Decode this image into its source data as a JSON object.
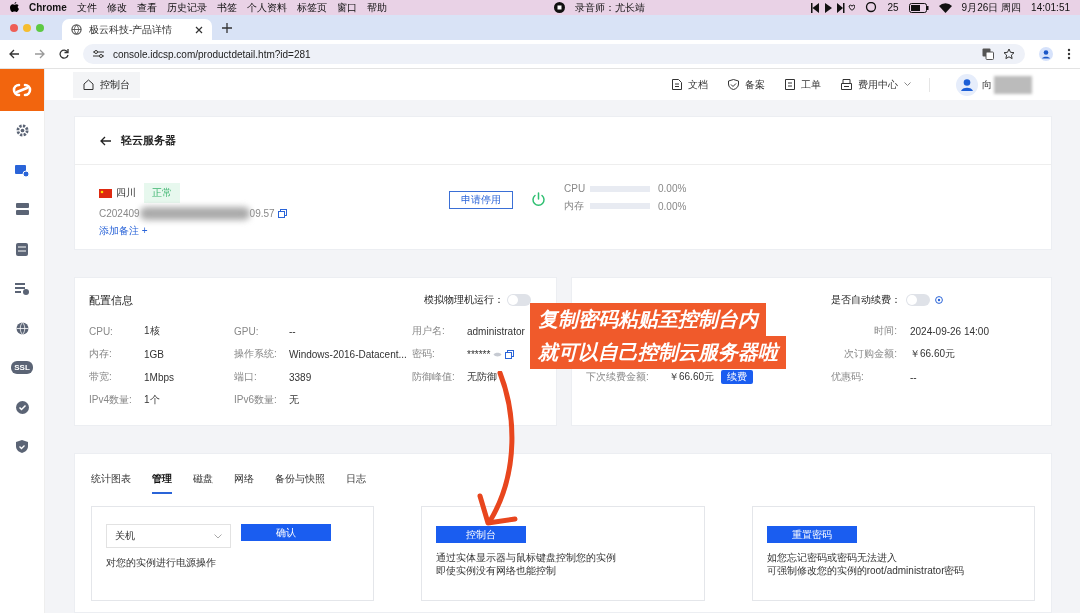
{
  "menubar": {
    "app": "Chrome",
    "items": [
      "文件",
      "修改",
      "查看",
      "历史记录",
      "书签",
      "个人资料",
      "标签页",
      "窗口",
      "帮助"
    ],
    "recorder": "录音师：尤长靖",
    "badge_count": "25",
    "date": "9月26日 周四",
    "time": "14:01:51"
  },
  "browser": {
    "tab_title": "极云科技-产品详情",
    "url": "console.idcsp.com/productdetail.htm?id=281"
  },
  "header": {
    "console": "控制台",
    "nav": [
      {
        "label": "文档",
        "kind": "doc"
      },
      {
        "label": "备案",
        "kind": "shield"
      },
      {
        "label": "工单",
        "kind": "ticket"
      },
      {
        "label": "费用中心",
        "kind": "cost"
      }
    ],
    "user": "向"
  },
  "sidebar": {
    "items": [
      {
        "kind": "gear",
        "selected": false
      },
      {
        "kind": "server",
        "selected": true
      },
      {
        "kind": "stack",
        "selected": false
      },
      {
        "kind": "db",
        "selected": false
      },
      {
        "kind": "list",
        "selected": false
      },
      {
        "kind": "globe",
        "selected": false
      },
      {
        "kind": "ssl",
        "label": "SSL",
        "selected": false
      },
      {
        "kind": "check",
        "selected": false
      },
      {
        "kind": "shield",
        "selected": false
      }
    ]
  },
  "server": {
    "title": "轻云服务器",
    "region": "四川",
    "status": "正常",
    "id_start": "C202409",
    "id_end": "09.57",
    "add_note": "添加备注 +",
    "stop_button": "申请停用",
    "running": true,
    "meters": [
      {
        "label": "CPU",
        "level": 0,
        "reading": "0.00%"
      },
      {
        "label": "内存",
        "level": 0,
        "reading": "0.00%"
      }
    ]
  },
  "config": {
    "title": "配置信息",
    "simulate_label": "模拟物理机运行：",
    "simulate_on": false,
    "rows": [
      [
        {
          "label": "CPU:",
          "value": "1核"
        },
        {
          "label": "GPU:",
          "value": "--"
        },
        {
          "label": "用户名:",
          "value": "administrator"
        }
      ],
      [
        {
          "label": "内存:",
          "value": "1GB"
        },
        {
          "label": "操作系统:",
          "value": "Windows-2016-Datacent..."
        },
        {
          "label": "密码:",
          "value": "******",
          "kind": "password"
        }
      ],
      [
        {
          "label": "带宽:",
          "value": "1Mbps"
        },
        {
          "label": "端口:",
          "value": "3389"
        },
        {
          "label": "防御峰值:",
          "value": "无防御"
        }
      ],
      [
        {
          "label": "IPv4数量:",
          "value": "1个"
        },
        {
          "label": "IPv6数量:",
          "value": "无"
        }
      ]
    ]
  },
  "billing": {
    "auto_renew_label": "是否自动续费：",
    "auto_renew_on": false,
    "expire_label": "时间:",
    "expire_value": "2024-09-26 14:00",
    "order_label": "次订购金额:",
    "order_value": "￥66.60元",
    "next_label": "下次续费金额:",
    "next_value": "￥66.60元",
    "renew_button": "续费",
    "coupon_label": "优惠码:",
    "coupon_value": "--"
  },
  "tabs": [
    {
      "label": "统计图表",
      "selected": false
    },
    {
      "label": "管理",
      "selected": true
    },
    {
      "label": "磁盘",
      "selected": false
    },
    {
      "label": "网络",
      "selected": false
    },
    {
      "label": "备份与快照",
      "selected": false
    },
    {
      "label": "日志",
      "selected": false
    }
  ],
  "panels": [
    {
      "kind": "power",
      "select": "关机",
      "button": "确认",
      "lines": [
        "对您的实例进行电源操作"
      ]
    },
    {
      "kind": "console",
      "button": "控制台",
      "lines": [
        "通过实体显示器与鼠标键盘控制您的实例",
        "即使实例没有网络也能控制"
      ]
    },
    {
      "kind": "reset",
      "button": "重置密码",
      "lines": [
        "如您忘记密码或密码无法进入",
        "可强制修改您的实例的root/administrator密码"
      ]
    }
  ],
  "caption": [
    "复制密码粘贴至控制台内",
    "就可以自己控制云服务器啦"
  ]
}
